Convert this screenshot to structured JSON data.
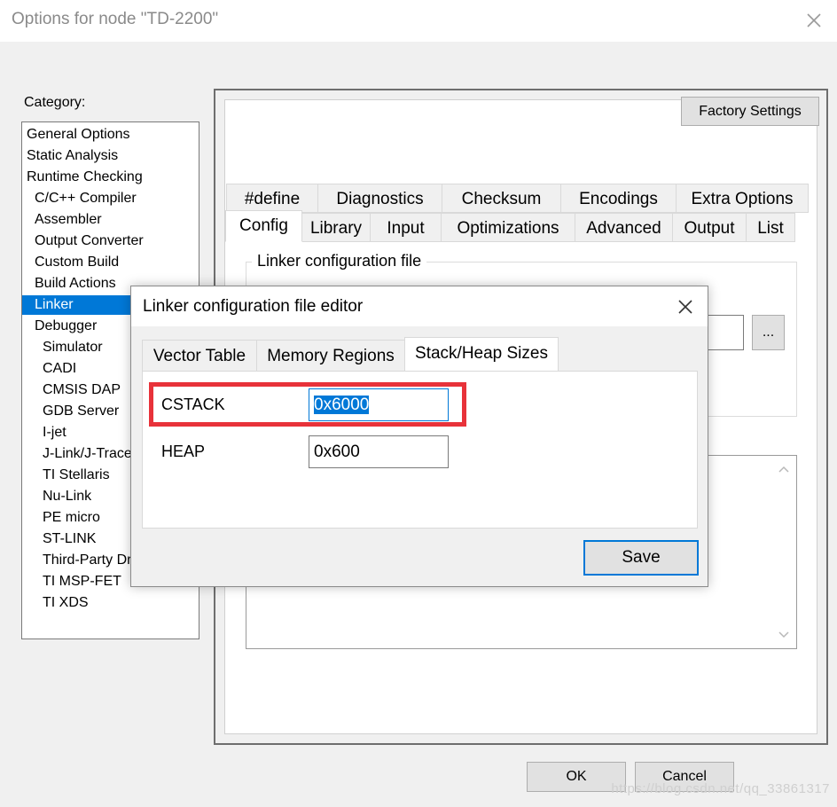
{
  "window": {
    "title": "Options for node \"TD-2200\""
  },
  "category": {
    "label": "Category:",
    "items": [
      {
        "label": "General Options",
        "indent": 0
      },
      {
        "label": "Static Analysis",
        "indent": 0
      },
      {
        "label": "Runtime Checking",
        "indent": 0
      },
      {
        "label": "C/C++ Compiler",
        "indent": 1
      },
      {
        "label": "Assembler",
        "indent": 1
      },
      {
        "label": "Output Converter",
        "indent": 1
      },
      {
        "label": "Custom Build",
        "indent": 1
      },
      {
        "label": "Build Actions",
        "indent": 1
      },
      {
        "label": "Linker",
        "indent": 1,
        "selected": true
      },
      {
        "label": "Debugger",
        "indent": 1
      },
      {
        "label": "Simulator",
        "indent": 2
      },
      {
        "label": "CADI",
        "indent": 2
      },
      {
        "label": "CMSIS DAP",
        "indent": 2
      },
      {
        "label": "GDB Server",
        "indent": 2
      },
      {
        "label": "I-jet",
        "indent": 2
      },
      {
        "label": "J-Link/J-Trace",
        "indent": 2
      },
      {
        "label": "TI Stellaris",
        "indent": 2
      },
      {
        "label": "Nu-Link",
        "indent": 2
      },
      {
        "label": "PE micro",
        "indent": 2
      },
      {
        "label": "ST-LINK",
        "indent": 2
      },
      {
        "label": "Third-Party Dr",
        "indent": 2
      },
      {
        "label": "TI MSP-FET",
        "indent": 2
      },
      {
        "label": "TI XDS",
        "indent": 2
      }
    ]
  },
  "panel": {
    "factory_settings": "Factory Settings",
    "tabs_row1": [
      "#define",
      "Diagnostics",
      "Checksum",
      "Encodings",
      "Extra Options"
    ],
    "tabs_row2": [
      "Config",
      "Library",
      "Input",
      "Optimizations",
      "Advanced",
      "Output",
      "List"
    ],
    "active_tab": "Config",
    "group_label": "Linker configuration file",
    "browse_label": "..."
  },
  "footer": {
    "ok": "OK",
    "cancel": "Cancel"
  },
  "dialog": {
    "title": "Linker configuration file editor",
    "tabs": [
      "Vector Table",
      "Memory Regions",
      "Stack/Heap Sizes"
    ],
    "active_tab": "Stack/Heap Sizes",
    "cstack_label": "CSTACK",
    "cstack_value": "0x6000",
    "heap_label": "HEAP",
    "heap_value": "0x600",
    "save": "Save"
  },
  "watermark": "https://blog.csdn.net/qq_33861317"
}
